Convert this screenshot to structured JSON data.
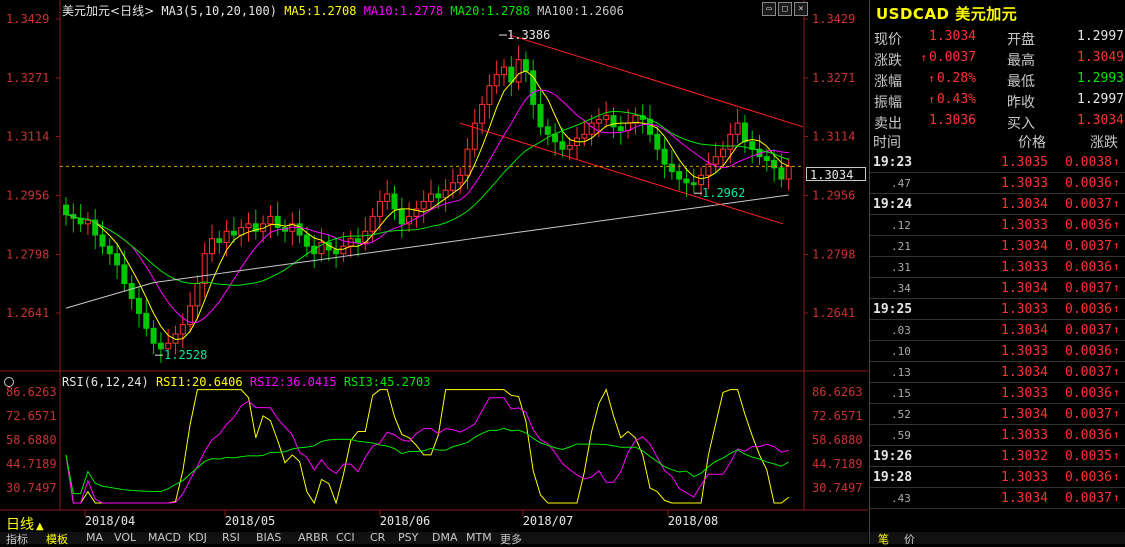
{
  "header": {
    "symbol_name": "美元加元",
    "period": "<日线>",
    "ma_def": "MA3(5,10,20,100)",
    "ma5": "MA5:1.2708",
    "ma10": "MA10:1.2778",
    "ma20": "MA20:1.2788",
    "ma100": "MA100:1.2606"
  },
  "colors": {
    "ma5": "#ffff00",
    "ma10": "#ff00ff",
    "ma20": "#00e600",
    "ma100": "#c8c8c8",
    "up": "#ff3232",
    "down": "#00c800",
    "channel": "#ff2020",
    "axis": "#c83232"
  },
  "price_axis": [
    "1.3429",
    "1.3271",
    "1.3114",
    "1.2956",
    "1.2798",
    "1.2641"
  ],
  "current_price_tag": "1.3034",
  "annotations": {
    "high": "1.3386",
    "low": "1.2528",
    "mid_low": "1.2962"
  },
  "rsi": {
    "label": "RSI(6,12,24)",
    "rsi1": "RSI1:20.6406",
    "rsi2": "RSI2:36.0415",
    "rsi3": "RSI3:45.2703",
    "axis": [
      "86.6263",
      "72.6571",
      "58.6880",
      "44.7189",
      "30.7497"
    ]
  },
  "date_axis": [
    "2018/04",
    "2018/05",
    "2018/06",
    "2018/07",
    "2018/08"
  ],
  "period_button": "日线",
  "bottom_tabs": [
    "指标",
    "模板",
    "MA",
    "VOL",
    "MACD",
    "KDJ",
    "RSI",
    "BIAS",
    "ARBR",
    "CCI",
    "CR",
    "PSY",
    "DMA",
    "MTM",
    "更多"
  ],
  "quote": {
    "title": "USDCAD 美元加元",
    "rows": [
      {
        "l1": "现价",
        "v1": "1.3034",
        "c1": "red",
        "a1": "",
        "l2": "开盘",
        "v2": "1.2997",
        "c2": "white"
      },
      {
        "l1": "涨跌",
        "v1": "0.0037",
        "c1": "red",
        "a1": "↑",
        "l2": "最高",
        "v2": "1.3049",
        "c2": "red"
      },
      {
        "l1": "涨幅",
        "v1": "0.28%",
        "c1": "red",
        "a1": "↑",
        "l2": "最低",
        "v2": "1.2993",
        "c2": "green"
      },
      {
        "l1": "振幅",
        "v1": "0.43%",
        "c1": "red",
        "a1": "↑",
        "l2": "昨收",
        "v2": "1.2997",
        "c2": "white"
      },
      {
        "l1": "卖出",
        "v1": "1.3036",
        "c1": "red",
        "a1": "",
        "l2": "买入",
        "v2": "1.3034",
        "c2": "red"
      }
    ],
    "ticks_header": {
      "time": "时间",
      "price": "价格",
      "change": "涨跌"
    },
    "ticks": [
      {
        "time": "19:23",
        "price": "1.3035",
        "change": "0.0038"
      },
      {
        "time": ".47",
        "price": "1.3033",
        "change": "0.0036"
      },
      {
        "time": "19:24",
        "price": "1.3034",
        "change": "0.0037"
      },
      {
        "time": ".12",
        "price": "1.3033",
        "change": "0.0036"
      },
      {
        "time": ".21",
        "price": "1.3034",
        "change": "0.0037"
      },
      {
        "time": ".31",
        "price": "1.3033",
        "change": "0.0036"
      },
      {
        "time": ".34",
        "price": "1.3034",
        "change": "0.0037"
      },
      {
        "time": "19:25",
        "price": "1.3033",
        "change": "0.0036"
      },
      {
        "time": ".03",
        "price": "1.3034",
        "change": "0.0037"
      },
      {
        "time": ".10",
        "price": "1.3033",
        "change": "0.0036"
      },
      {
        "time": ".13",
        "price": "1.3034",
        "change": "0.0037"
      },
      {
        "time": ".15",
        "price": "1.3033",
        "change": "0.0036"
      },
      {
        "time": ".52",
        "price": "1.3034",
        "change": "0.0037"
      },
      {
        "time": ".59",
        "price": "1.3033",
        "change": "0.0036"
      },
      {
        "time": "19:26",
        "price": "1.3032",
        "change": "0.0035"
      },
      {
        "time": "19:28",
        "price": "1.3033",
        "change": "0.0036"
      },
      {
        "time": ".43",
        "price": "1.3034",
        "change": "0.0037"
      }
    ],
    "bottom_tabs": [
      "笔",
      "价"
    ]
  }
}
